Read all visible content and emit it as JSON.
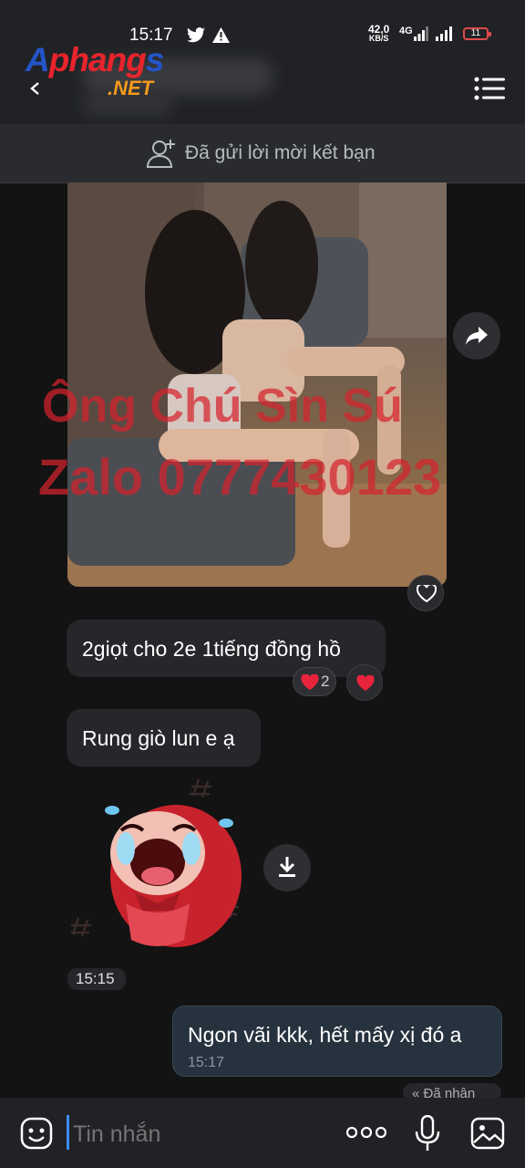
{
  "status_bar": {
    "time": "15:17",
    "net_speed": "42,0",
    "net_unit": "KB/S",
    "net_type": "4G",
    "battery": "11"
  },
  "header": {
    "watermark_logo": "Aphangs",
    "watermark_logo_suffix": ".NET",
    "menu_icon": "hamburger-icon"
  },
  "banner": {
    "text": "Đã gửi lời mời kết bạn",
    "icon": "add-friend-icon"
  },
  "photo": {
    "watermark_line1": "Ông Chú Sìn Sú",
    "watermark_line2": "Zalo 0777430123"
  },
  "messages": [
    {
      "text": "2giọt cho 2e 1tiếng đồng hồ",
      "reaction_count": "2"
    },
    {
      "text": "Rung giò lun e ạ"
    },
    {
      "type": "sticker",
      "time": "15:15"
    },
    {
      "text": "Ngon vãi kkk, hết mấy xị đó a",
      "time": "15:17",
      "status": "Đã nhận"
    }
  ],
  "composer": {
    "placeholder": "Tin nhắn"
  },
  "colors": {
    "accent": "#3b8cff",
    "heart": "#e8243c",
    "watermark": "#d6232d"
  }
}
